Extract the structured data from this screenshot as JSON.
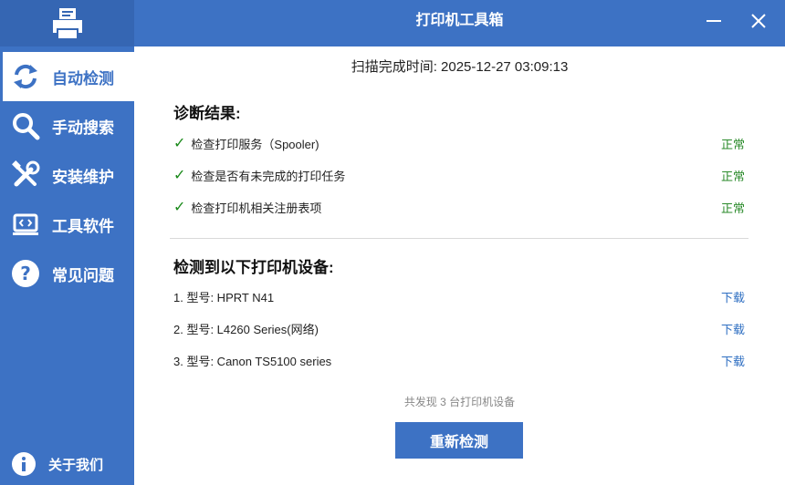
{
  "app": {
    "title": "打印机工具箱"
  },
  "sidebar": {
    "items": [
      {
        "label": "自动检测",
        "icon": "refresh-icon",
        "active": true
      },
      {
        "label": "手动搜索",
        "icon": "search-icon",
        "active": false
      },
      {
        "label": "安装维护",
        "icon": "tools-icon",
        "active": false
      },
      {
        "label": "工具软件",
        "icon": "monitor-code-icon",
        "active": false
      },
      {
        "label": "常见问题",
        "icon": "question-icon",
        "active": false
      }
    ],
    "about": {
      "label": "关于我们",
      "icon": "info-icon"
    }
  },
  "main": {
    "scan_time": "扫描完成时间: 2025-12-27 03:09:13",
    "diagnosis": {
      "title": "诊断结果:",
      "items": [
        {
          "label": "检查打印服务（Spooler)",
          "status": "正常"
        },
        {
          "label": "检查是否有未完成的打印任务",
          "status": "正常"
        },
        {
          "label": "检查打印机相关注册表项",
          "status": "正常"
        }
      ]
    },
    "devices": {
      "title": "检测到以下打印机设备:",
      "items": [
        {
          "label": "1. 型号: HPRT N41",
          "action": "下载"
        },
        {
          "label": "2. 型号: L4260 Series(网络)",
          "action": "下载"
        },
        {
          "label": "3. 型号: Canon TS5100 series",
          "action": "下载"
        }
      ]
    },
    "summary": "共发现 3 台打印机设备",
    "rescan_label": "重新检测"
  },
  "colors": {
    "primary": "#3d72c4",
    "status_ok": "#2a8a2a",
    "link": "#2f6fc2"
  }
}
